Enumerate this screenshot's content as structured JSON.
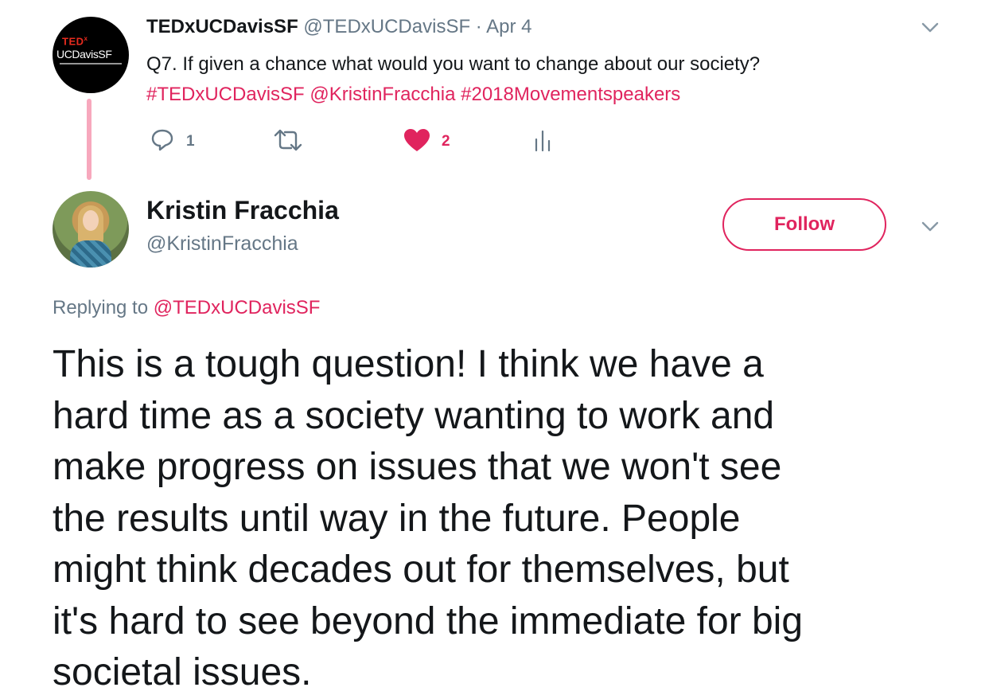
{
  "parent_tweet": {
    "avatar": {
      "logo_top": "TED",
      "logo_sup": "x",
      "logo_bottom": "UCDavisSF"
    },
    "author_name": "TEDxUCDavisSF",
    "author_handle": "@TEDxUCDavisSF",
    "separator": "·",
    "date": "Apr 4",
    "text": "Q7. If given a chance what would you want to change about our society?",
    "links": [
      "#TEDxUCDavisSF",
      "@KristinFracchia",
      "#2018Movementspeakers"
    ],
    "actions": {
      "reply_count": "1",
      "like_count": "2",
      "icons": [
        "reply-icon",
        "retweet-icon",
        "heart-icon",
        "analytics-icon"
      ]
    }
  },
  "reply_tweet": {
    "author_name": "Kristin Fracchia",
    "author_handle": "@KristinFracchia",
    "follow_label": "Follow",
    "replying_prefix": "Replying to",
    "replying_handle": "@TEDxUCDavisSF",
    "lines": [
      "This is a tough question! I think we have a",
      "hard time as a society wanting to work and",
      "make progress on issues that we won't see",
      "the results until way in the future. People",
      "might think decades out for themselves, but",
      "it's hard to see beyond the immediate for big",
      "societal issues."
    ]
  },
  "colors": {
    "accent": "#e0245e",
    "secondary_text": "#657786",
    "primary_text": "#14171a",
    "thread_line": "#f7a8bd"
  }
}
